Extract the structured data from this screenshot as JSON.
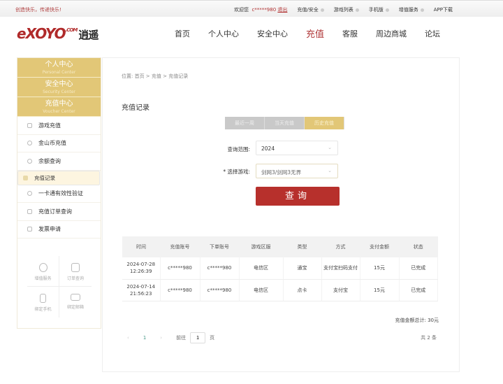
{
  "topbar": {
    "slogan": "创造快乐，传递快乐!",
    "welcome": "欢迎您",
    "user": "c*****980",
    "logout": "退出",
    "links": [
      "充值/安全",
      "游戏列表",
      "手机版",
      "增值服务"
    ],
    "app": "APP下载"
  },
  "logo": {
    "text": "eXOYO",
    "com": ".COM",
    "cn": "逍遥"
  },
  "nav": [
    "首页",
    "个人中心",
    "安全中心",
    "充值",
    "客服",
    "周边商城",
    "论坛"
  ],
  "sidebar": {
    "sections": [
      {
        "title": "个人中心",
        "sub": "Personal Center"
      },
      {
        "title": "安全中心",
        "sub": "Security Center"
      },
      {
        "title": "充值中心",
        "sub": "Voucher Center"
      }
    ],
    "items": [
      "游戏充值",
      "金山币充值",
      "余额查询",
      "充值记录",
      "一卡通有效性验证",
      "充值订单查询",
      "发票申请"
    ],
    "quick": [
      "增值服务",
      "订单查询",
      "绑定手机",
      "绑定邮箱"
    ]
  },
  "breadcrumb": "位置:  首页 > 充值 > 充值记录",
  "title": "充值记录",
  "tabs": [
    "最近一周",
    "当天充值",
    "历史充值"
  ],
  "form": {
    "range_label": "查询范围:",
    "range_value": "2024",
    "game_label": "* 选择游戏:",
    "game_value": "剑网3/剑网3无界",
    "query": "查询"
  },
  "table": {
    "headers": [
      "时间",
      "充值账号",
      "下单账号",
      "游戏区服",
      "类型",
      "方式",
      "支付金额",
      "状态"
    ],
    "rows": [
      [
        "2024-07-28",
        "12:26:39",
        "c*****980",
        "c*****980",
        "电信区",
        "通宝",
        "支付宝扫码支付",
        "15元",
        "已完成"
      ],
      [
        "2024-07-14",
        "21:56:23",
        "c*****980",
        "c*****980",
        "电信区",
        "点卡",
        "支付宝",
        "15元",
        "已完成"
      ]
    ]
  },
  "total": "充值金额总计: 30元",
  "pagination": {
    "prev": "‹",
    "page": "1",
    "next": "›",
    "goto": "前往",
    "input": "1",
    "unit": "页",
    "count": "共 2 条"
  }
}
